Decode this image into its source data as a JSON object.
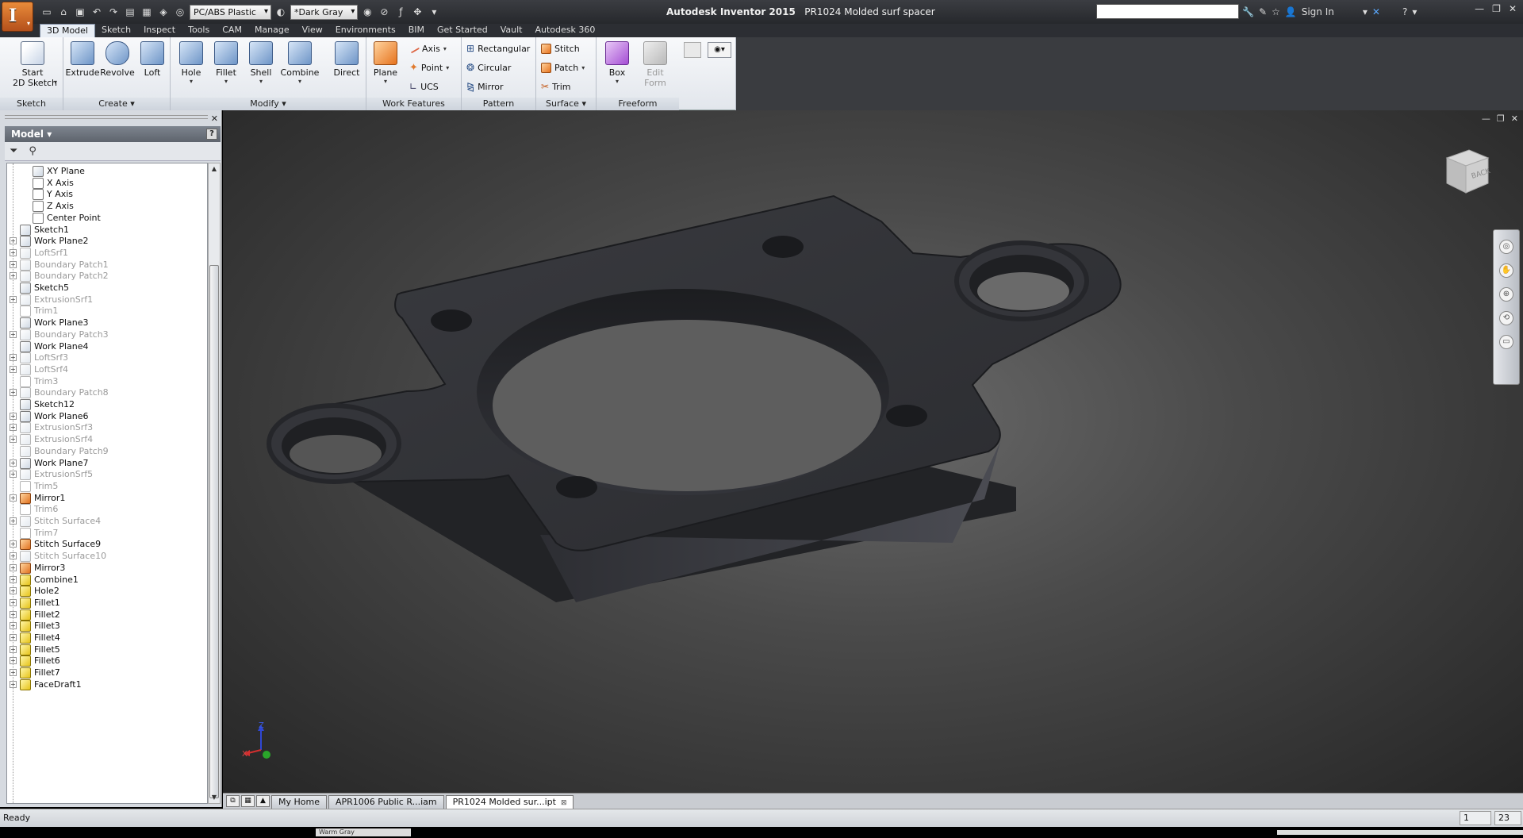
{
  "title_bar": {
    "app_name": "Autodesk Inventor 2015",
    "document": "PR1024 Molded surf spacer",
    "material": "PC/ABS Plastic",
    "appearance": "*Dark Gray",
    "sign_in": "Sign In",
    "search_placeholder": ""
  },
  "ribbon_tabs": [
    "3D Model",
    "Sketch",
    "Inspect",
    "Tools",
    "CAM",
    "Manage",
    "View",
    "Environments",
    "BIM",
    "Get Started",
    "Vault",
    "Autodesk 360"
  ],
  "ribbon": {
    "sketch": {
      "start_line1": "Start",
      "start_line2": "2D Sketch",
      "label": "Sketch"
    },
    "create": {
      "extrude": "Extrude",
      "revolve": "Revolve",
      "loft": "Loft",
      "label": "Create"
    },
    "modify": {
      "hole": "Hole",
      "fillet": "Fillet",
      "shell": "Shell",
      "combine": "Combine",
      "direct": "Direct",
      "label": "Modify"
    },
    "work_features": {
      "plane": "Plane",
      "axis": "Axis",
      "point": "Point",
      "ucs": "UCS",
      "label": "Work Features"
    },
    "pattern": {
      "rectangular": "Rectangular",
      "circular": "Circular",
      "mirror": "Mirror",
      "label": "Pattern"
    },
    "surface": {
      "stitch": "Stitch",
      "patch": "Patch",
      "trim": "Trim",
      "label": "Surface"
    },
    "freeform": {
      "box": "Box",
      "edit_form_line1": "Edit",
      "edit_form_line2": "Form",
      "label": "Freeform"
    }
  },
  "browser": {
    "title": "Model",
    "help": "?",
    "items": [
      {
        "label": "XY Plane",
        "level": 2,
        "expand": false,
        "icon": "plane",
        "suppressed": false
      },
      {
        "label": "X Axis",
        "level": 2,
        "expand": false,
        "icon": "axis",
        "suppressed": false
      },
      {
        "label": "Y Axis",
        "level": 2,
        "expand": false,
        "icon": "axis",
        "suppressed": false
      },
      {
        "label": "Z Axis",
        "level": 2,
        "expand": false,
        "icon": "axis",
        "suppressed": false
      },
      {
        "label": "Center Point",
        "level": 2,
        "expand": false,
        "icon": "point",
        "suppressed": false
      },
      {
        "label": "Sketch1",
        "level": 1,
        "expand": false,
        "icon": "sketch",
        "suppressed": false
      },
      {
        "label": "Work Plane2",
        "level": 1,
        "expand": true,
        "icon": "plane",
        "suppressed": false
      },
      {
        "label": "LoftSrf1",
        "level": 1,
        "expand": true,
        "icon": "surface",
        "suppressed": true
      },
      {
        "label": "Boundary Patch1",
        "level": 1,
        "expand": true,
        "icon": "surface",
        "suppressed": true
      },
      {
        "label": "Boundary Patch2",
        "level": 1,
        "expand": true,
        "icon": "surface",
        "suppressed": true
      },
      {
        "label": "Sketch5",
        "level": 1,
        "expand": false,
        "icon": "sketch",
        "suppressed": false
      },
      {
        "label": "ExtrusionSrf1",
        "level": 1,
        "expand": true,
        "icon": "surface",
        "suppressed": true
      },
      {
        "label": "Trim1",
        "level": 1,
        "expand": false,
        "icon": "trim",
        "suppressed": true
      },
      {
        "label": "Work Plane3",
        "level": 1,
        "expand": false,
        "icon": "plane",
        "suppressed": false
      },
      {
        "label": "Boundary Patch3",
        "level": 1,
        "expand": true,
        "icon": "surface",
        "suppressed": true
      },
      {
        "label": "Work Plane4",
        "level": 1,
        "expand": false,
        "icon": "plane",
        "suppressed": false
      },
      {
        "label": "LoftSrf3",
        "level": 1,
        "expand": true,
        "icon": "surface",
        "suppressed": true
      },
      {
        "label": "LoftSrf4",
        "level": 1,
        "expand": true,
        "icon": "surface",
        "suppressed": true
      },
      {
        "label": "Trim3",
        "level": 1,
        "expand": false,
        "icon": "trim",
        "suppressed": true
      },
      {
        "label": "Boundary Patch8",
        "level": 1,
        "expand": true,
        "icon": "surface",
        "suppressed": true
      },
      {
        "label": "Sketch12",
        "level": 1,
        "expand": false,
        "icon": "sketch",
        "suppressed": false
      },
      {
        "label": "Work Plane6",
        "level": 1,
        "expand": true,
        "icon": "plane",
        "suppressed": false
      },
      {
        "label": "ExtrusionSrf3",
        "level": 1,
        "expand": true,
        "icon": "surface",
        "suppressed": true
      },
      {
        "label": "ExtrusionSrf4",
        "level": 1,
        "expand": true,
        "icon": "surface",
        "suppressed": true
      },
      {
        "label": "Boundary Patch9",
        "level": 1,
        "expand": false,
        "icon": "surface",
        "suppressed": true
      },
      {
        "label": "Work Plane7",
        "level": 1,
        "expand": true,
        "icon": "plane",
        "suppressed": false
      },
      {
        "label": "ExtrusionSrf5",
        "level": 1,
        "expand": true,
        "icon": "surface",
        "suppressed": true
      },
      {
        "label": "Trim5",
        "level": 1,
        "expand": false,
        "icon": "trim",
        "suppressed": true
      },
      {
        "label": "Mirror1",
        "level": 1,
        "expand": true,
        "icon": "mirror",
        "suppressed": false
      },
      {
        "label": "Trim6",
        "level": 1,
        "expand": false,
        "icon": "trim",
        "suppressed": true
      },
      {
        "label": "Stitch Surface4",
        "level": 1,
        "expand": true,
        "icon": "stitch",
        "suppressed": true
      },
      {
        "label": "Trim7",
        "level": 1,
        "expand": false,
        "icon": "trim",
        "suppressed": true
      },
      {
        "label": "Stitch Surface9",
        "level": 1,
        "expand": true,
        "icon": "stitch-active",
        "suppressed": false
      },
      {
        "label": "Stitch Surface10",
        "level": 1,
        "expand": true,
        "icon": "stitch",
        "suppressed": true
      },
      {
        "label": "Mirror3",
        "level": 1,
        "expand": true,
        "icon": "mirror",
        "suppressed": false
      },
      {
        "label": "Combine1",
        "level": 1,
        "expand": true,
        "icon": "combine",
        "suppressed": false
      },
      {
        "label": "Hole2",
        "level": 1,
        "expand": true,
        "icon": "hole",
        "suppressed": false
      },
      {
        "label": "Fillet1",
        "level": 1,
        "expand": true,
        "icon": "fillet",
        "suppressed": false
      },
      {
        "label": "Fillet2",
        "level": 1,
        "expand": true,
        "icon": "fillet",
        "suppressed": false
      },
      {
        "label": "Fillet3",
        "level": 1,
        "expand": true,
        "icon": "fillet",
        "suppressed": false
      },
      {
        "label": "Fillet4",
        "level": 1,
        "expand": true,
        "icon": "fillet",
        "suppressed": false
      },
      {
        "label": "Fillet5",
        "level": 1,
        "expand": true,
        "icon": "fillet",
        "suppressed": false
      },
      {
        "label": "Fillet6",
        "level": 1,
        "expand": true,
        "icon": "fillet",
        "suppressed": false
      },
      {
        "label": "Fillet7",
        "level": 1,
        "expand": true,
        "icon": "fillet",
        "suppressed": false
      },
      {
        "label": "FaceDraft1",
        "level": 1,
        "expand": true,
        "icon": "facedraft",
        "suppressed": false
      }
    ]
  },
  "viewcube": {
    "face": "BACK"
  },
  "triad": {
    "x": "X",
    "z": "Z"
  },
  "doc_tabs": [
    "My Home",
    "APR1006 Public R...iam",
    "PR1024 Molded sur...ipt"
  ],
  "status": {
    "text": "Ready",
    "cell1": "1",
    "cell2": "23"
  },
  "taskstrip": {
    "ghost": "Warm Gray"
  },
  "colors": {
    "accent": "#e07a2e",
    "viewport_bg": "#4a4a4a",
    "part": "#2f3034",
    "suppressed_text": "#9a9a9a"
  }
}
